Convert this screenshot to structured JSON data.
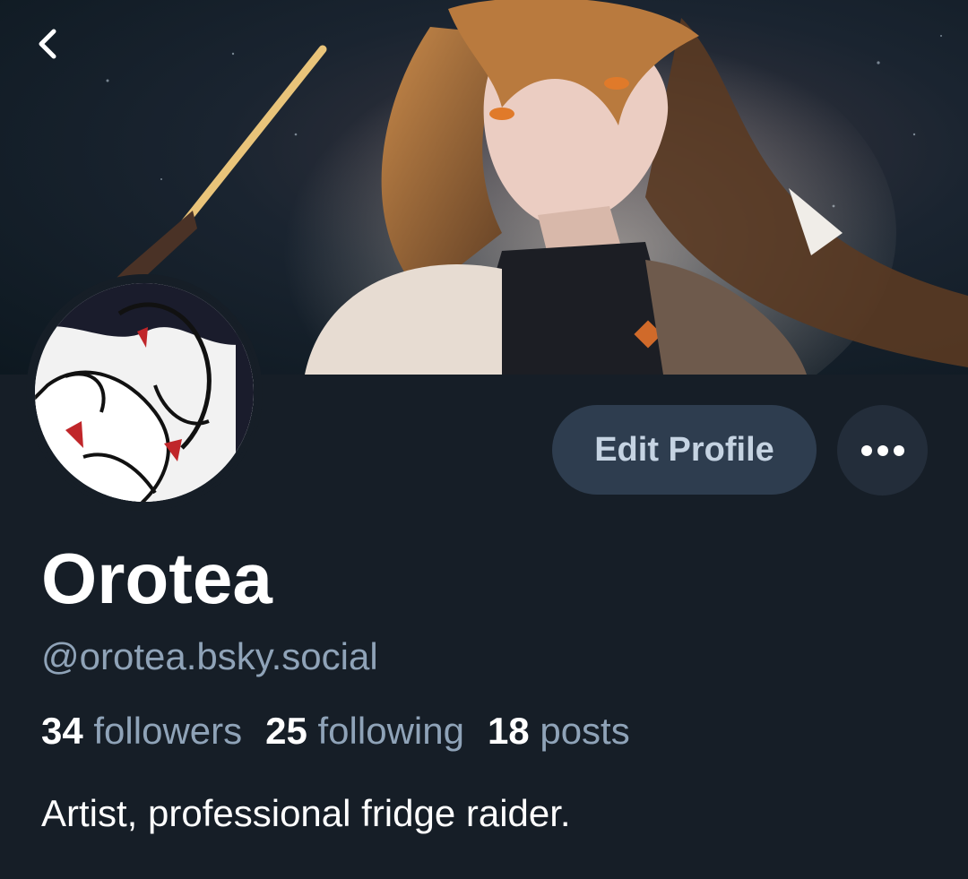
{
  "profile": {
    "display_name": "Orotea",
    "handle": "@orotea.bsky.social",
    "bio": "Artist, professional fridge raider."
  },
  "stats": {
    "followers_count": "34",
    "followers_label": "followers",
    "following_count": "25",
    "following_label": "following",
    "posts_count": "18",
    "posts_label": "posts"
  },
  "actions": {
    "edit_profile_label": "Edit Profile"
  },
  "icons": {
    "back": "chevron-left-icon",
    "more": "ellipsis-icon"
  },
  "colors": {
    "background": "#161e27",
    "button_bg": "#2e3d4f",
    "button_text": "#c5d3e2",
    "muted_text": "#8fa3b8"
  }
}
